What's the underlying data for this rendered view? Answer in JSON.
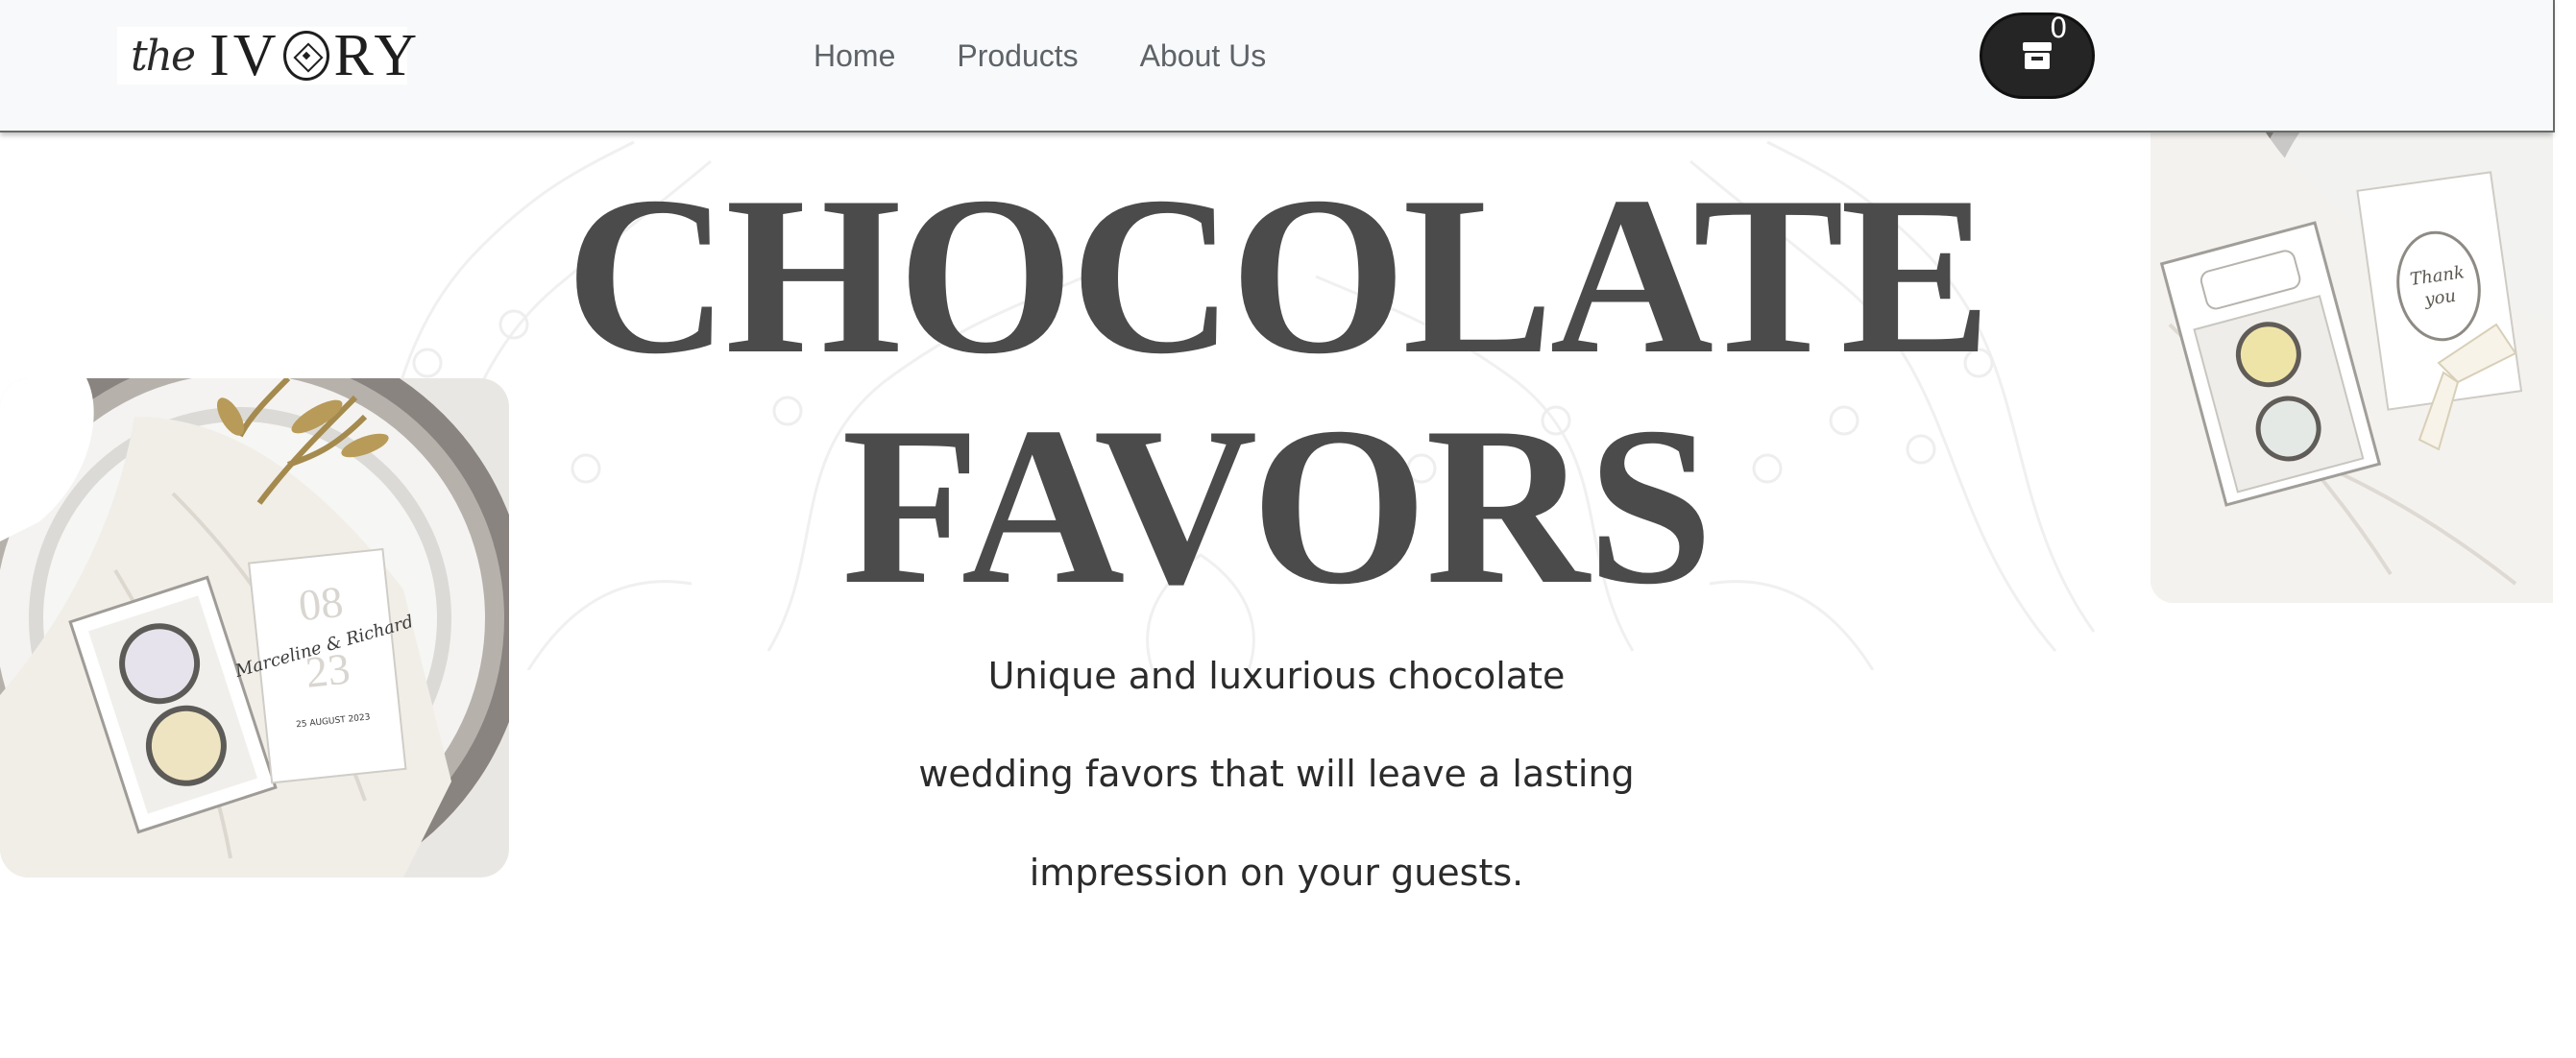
{
  "header": {
    "logo": {
      "the": "the",
      "word_start": "IV",
      "word_end": "RY"
    },
    "nav": [
      {
        "label": "Home"
      },
      {
        "label": "Products"
      },
      {
        "label": "About Us"
      }
    ],
    "cart": {
      "count": "0",
      "icon": "store-icon"
    }
  },
  "hero": {
    "headline_line1": "CHOCOLATE",
    "headline_line2": "FAVORS",
    "sub_line1": "Unique and luxurious chocolate",
    "sub_line2": "wedding favors that will leave a lasting",
    "sub_line3": "impression on your guests."
  },
  "images": {
    "left_card": {
      "names": "Marceline & Richard",
      "date_top": "08",
      "date_bottom": "23",
      "date_text": "25 AUGUST 2023"
    },
    "right_card": {
      "thanks_line1": "Thank",
      "thanks_line2": "you"
    }
  },
  "colors": {
    "header_bg": "#f8f9fa",
    "nav_text": "#5e6368",
    "cart_bg": "#252525",
    "headline": "#4b4b4b",
    "body_text": "#2b2b2b"
  }
}
